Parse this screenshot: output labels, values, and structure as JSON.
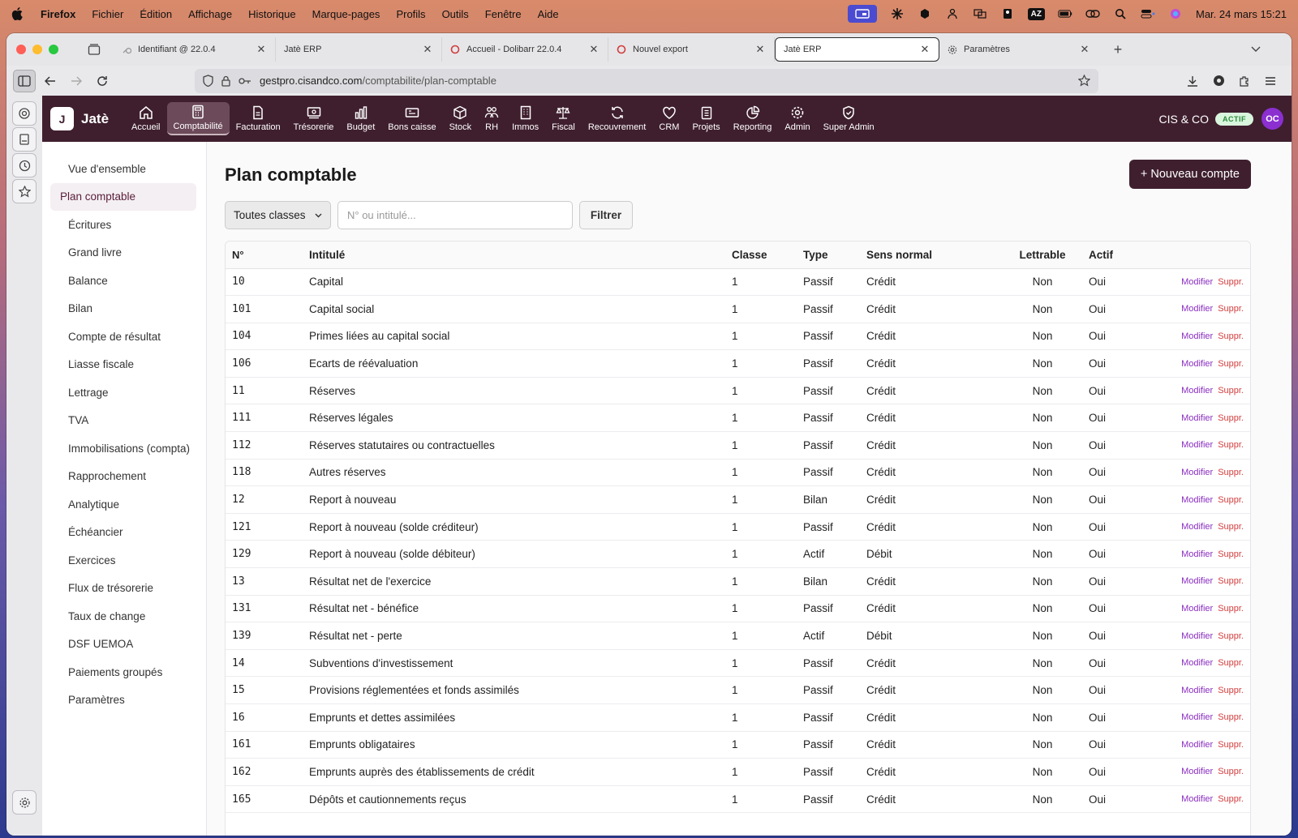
{
  "menubar": {
    "app": "Firefox",
    "items": [
      "Fichier",
      "Édition",
      "Affichage",
      "Historique",
      "Marque-pages",
      "Profils",
      "Outils",
      "Fenêtre",
      "Aide"
    ],
    "az": "AZ",
    "datetime": "Mar. 24 mars  15:21"
  },
  "browser": {
    "tabs": [
      {
        "label": "Identifiant @ 22.0.4",
        "icon": "key-icon"
      },
      {
        "label": "Jatè ERP",
        "icon": ""
      },
      {
        "label": "Accueil - Dolibarr 22.0.4",
        "icon": "dolibarr-icon"
      },
      {
        "label": "Nouvel export",
        "icon": "dolibarr-icon"
      },
      {
        "label": "Jatè ERP",
        "icon": ""
      },
      {
        "label": "Paramètres",
        "icon": "gear-icon"
      }
    ],
    "url_host": "gestpro.cisandco.com",
    "url_path": "/comptabilite/plan-comptable"
  },
  "app": {
    "logo_letter": "J",
    "logo_name": "Jatè",
    "nav": [
      {
        "label": "Accueil",
        "icon": "home-icon"
      },
      {
        "label": "Comptabilité",
        "icon": "calculator-icon"
      },
      {
        "label": "Facturation",
        "icon": "document-icon"
      },
      {
        "label": "Trésorerie",
        "icon": "cash-icon"
      },
      {
        "label": "Budget",
        "icon": "bar-chart-icon"
      },
      {
        "label": "Bons caisse",
        "icon": "ticket-icon"
      },
      {
        "label": "Stock",
        "icon": "box-icon"
      },
      {
        "label": "RH",
        "icon": "users-icon"
      },
      {
        "label": "Immos",
        "icon": "building-icon"
      },
      {
        "label": "Fiscal",
        "icon": "scale-icon"
      },
      {
        "label": "Recouvrement",
        "icon": "refresh-icon"
      },
      {
        "label": "CRM",
        "icon": "heart-icon"
      },
      {
        "label": "Projets",
        "icon": "clipboard-icon"
      },
      {
        "label": "Reporting",
        "icon": "pie-chart-icon"
      },
      {
        "label": "Admin",
        "icon": "cog-icon"
      },
      {
        "label": "Super Admin",
        "icon": "shield-icon"
      }
    ],
    "company": "CIS & CO",
    "status_badge": "ACTIF",
    "avatar": "OC",
    "accent": "#3f1f2e"
  },
  "sidebar": {
    "items": [
      "Vue d'ensemble",
      "Plan comptable",
      "Écritures",
      "Grand livre",
      "Balance",
      "Bilan",
      "Compte de résultat",
      "Liasse fiscale",
      "Lettrage",
      "TVA",
      "Immobilisations (compta)",
      "Rapprochement",
      "Analytique",
      "Échéancier",
      "Exercices",
      "Flux de trésorerie",
      "Taux de change",
      "DSF UEMOA",
      "Paiements groupés",
      "Paramètres"
    ],
    "active": "Plan comptable"
  },
  "page": {
    "title": "Plan comptable",
    "new_button": "+ Nouveau compte",
    "filter_select": "Toutes classes",
    "search_placeholder": "N° ou intitulé...",
    "filter_button": "Filtrer"
  },
  "table": {
    "headers": [
      "N°",
      "Intitulé",
      "Classe",
      "Type",
      "Sens normal",
      "Lettrable",
      "Actif"
    ],
    "edit_label": "Modifier",
    "delete_label": "Suppr.",
    "rows": [
      [
        "10",
        "Capital",
        "1",
        "Passif",
        "Crédit",
        "Non",
        "Oui"
      ],
      [
        "101",
        "Capital social",
        "1",
        "Passif",
        "Crédit",
        "Non",
        "Oui"
      ],
      [
        "104",
        "Primes liées au capital social",
        "1",
        "Passif",
        "Crédit",
        "Non",
        "Oui"
      ],
      [
        "106",
        "Ecarts de réévaluation",
        "1",
        "Passif",
        "Crédit",
        "Non",
        "Oui"
      ],
      [
        "11",
        "Réserves",
        "1",
        "Passif",
        "Crédit",
        "Non",
        "Oui"
      ],
      [
        "111",
        "Réserves légales",
        "1",
        "Passif",
        "Crédit",
        "Non",
        "Oui"
      ],
      [
        "112",
        "Réserves statutaires ou contractuelles",
        "1",
        "Passif",
        "Crédit",
        "Non",
        "Oui"
      ],
      [
        "118",
        "Autres réserves",
        "1",
        "Passif",
        "Crédit",
        "Non",
        "Oui"
      ],
      [
        "12",
        "Report à nouveau",
        "1",
        "Bilan",
        "Crédit",
        "Non",
        "Oui"
      ],
      [
        "121",
        "Report à nouveau (solde créditeur)",
        "1",
        "Passif",
        "Crédit",
        "Non",
        "Oui"
      ],
      [
        "129",
        "Report à nouveau (solde débiteur)",
        "1",
        "Actif",
        "Débit",
        "Non",
        "Oui"
      ],
      [
        "13",
        "Résultat net de l'exercice",
        "1",
        "Bilan",
        "Crédit",
        "Non",
        "Oui"
      ],
      [
        "131",
        "Résultat net - bénéfice",
        "1",
        "Passif",
        "Crédit",
        "Non",
        "Oui"
      ],
      [
        "139",
        "Résultat net - perte",
        "1",
        "Actif",
        "Débit",
        "Non",
        "Oui"
      ],
      [
        "14",
        "Subventions d'investissement",
        "1",
        "Passif",
        "Crédit",
        "Non",
        "Oui"
      ],
      [
        "15",
        "Provisions réglementées et fonds assimilés",
        "1",
        "Passif",
        "Crédit",
        "Non",
        "Oui"
      ],
      [
        "16",
        "Emprunts et dettes assimilées",
        "1",
        "Passif",
        "Crédit",
        "Non",
        "Oui"
      ],
      [
        "161",
        "Emprunts obligataires",
        "1",
        "Passif",
        "Crédit",
        "Non",
        "Oui"
      ],
      [
        "162",
        "Emprunts auprès des établissements de crédit",
        "1",
        "Passif",
        "Crédit",
        "Non",
        "Oui"
      ],
      [
        "165",
        "Dépôts et cautionnements reçus",
        "1",
        "Passif",
        "Crédit",
        "Non",
        "Oui"
      ]
    ]
  }
}
